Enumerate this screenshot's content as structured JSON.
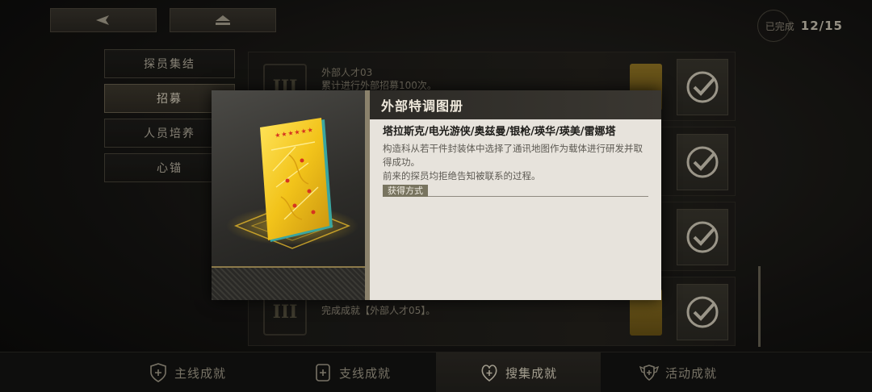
{
  "top_nav": {
    "back_icon": "back-arrow-icon",
    "home_icon": "home-icon"
  },
  "progress": {
    "label": "已完成",
    "count": "12/15"
  },
  "side_menu": {
    "items": [
      {
        "label": "探员集结"
      },
      {
        "label": "招募"
      },
      {
        "label": "人员培养"
      },
      {
        "label": "心锚"
      }
    ],
    "active_index": 1
  },
  "achievements": [
    {
      "emblem": "III",
      "title": "外部人才03",
      "desc": "累计进行外部招募100次。"
    },
    {
      "emblem": "",
      "title": "",
      "desc": ""
    },
    {
      "emblem": "",
      "title": "",
      "desc": ""
    },
    {
      "emblem": "III",
      "title": "",
      "desc": "完成成就【外部人才05】。"
    }
  ],
  "tabbar": {
    "tabs": [
      {
        "label": "主线成就",
        "icon": "shield-plus-icon"
      },
      {
        "label": "支线成就",
        "icon": "shield-plus-icon"
      },
      {
        "label": "搜集成就",
        "icon": "heart-shield-icon"
      },
      {
        "label": "活动成就",
        "icon": "winged-shield-icon"
      }
    ],
    "active_index": 2
  },
  "modal": {
    "header": "外部特调图册",
    "name": "塔拉斯克/电光游侠/奥兹曼/银枪/瑛华/瑛美/雷娜塔",
    "description_line1": "构造科从若干件封装体中选择了通讯地图作为载体进行研发并取得成功。",
    "description_line2": "前来的探员均拒绝告知被联系的过程。",
    "acquire_label": "获得方式",
    "stars": "★★★★★★"
  },
  "colors": {
    "gold": "#f2c31a",
    "panel": "#e7e3dc",
    "header": "#2c2a26"
  }
}
